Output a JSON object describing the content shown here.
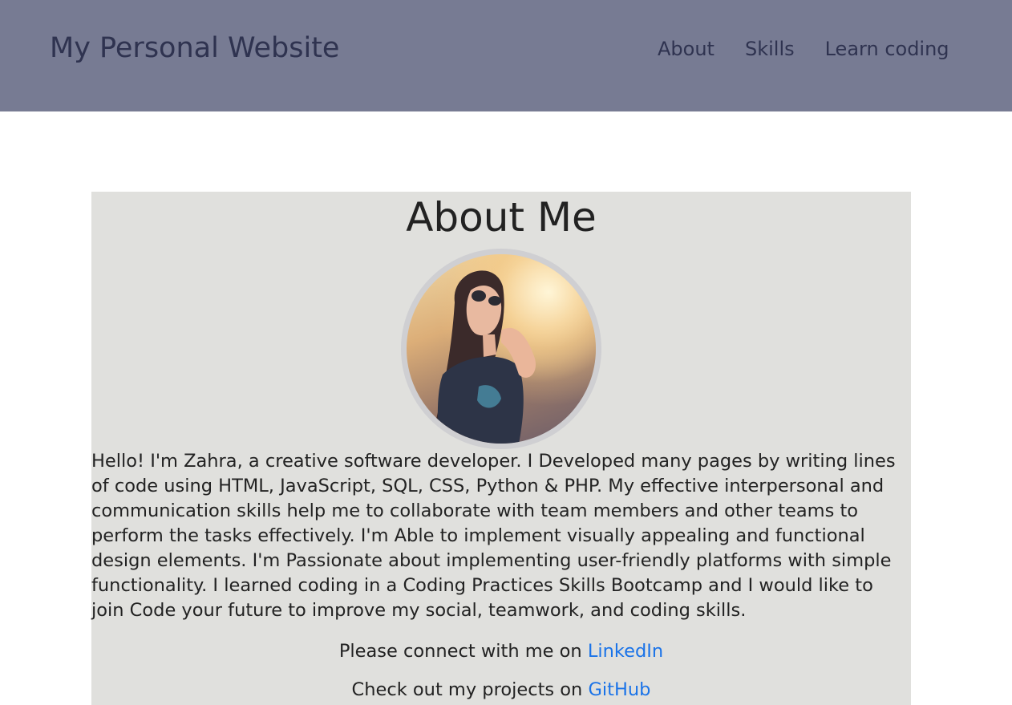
{
  "header": {
    "site_title": "My Personal Website",
    "nav": [
      {
        "label": "About"
      },
      {
        "label": "Skills"
      },
      {
        "label": "Learn coding"
      }
    ],
    "background_color": "#777b93",
    "text_color": "#2f3350"
  },
  "about": {
    "heading": "About Me",
    "avatar_alt": "Profile photo",
    "bio": "Hello! I'm Zahra, a creative software developer. I Developed many pages by writing lines of code using HTML, JavaScript, SQL, CSS, Python & PHP. My effective interpersonal and communication skills help me to collaborate with team members and other teams to perform the tasks effectively. I'm Able to implement visually appealing and functional design elements. I'm Passionate about implementing user-friendly platforms with simple functionality. I learned coding in a Coding Practices Skills Bootcamp and I would like to join Code your future to improve my social, teamwork, and coding skills.",
    "connect_text": "Please connect with me on ",
    "connect_link": "LinkedIn",
    "checkout_text": "Check out my projects on ",
    "checkout_link": "GitHub",
    "background_color": "#e0e0dd",
    "link_color": "#1a73e8"
  }
}
